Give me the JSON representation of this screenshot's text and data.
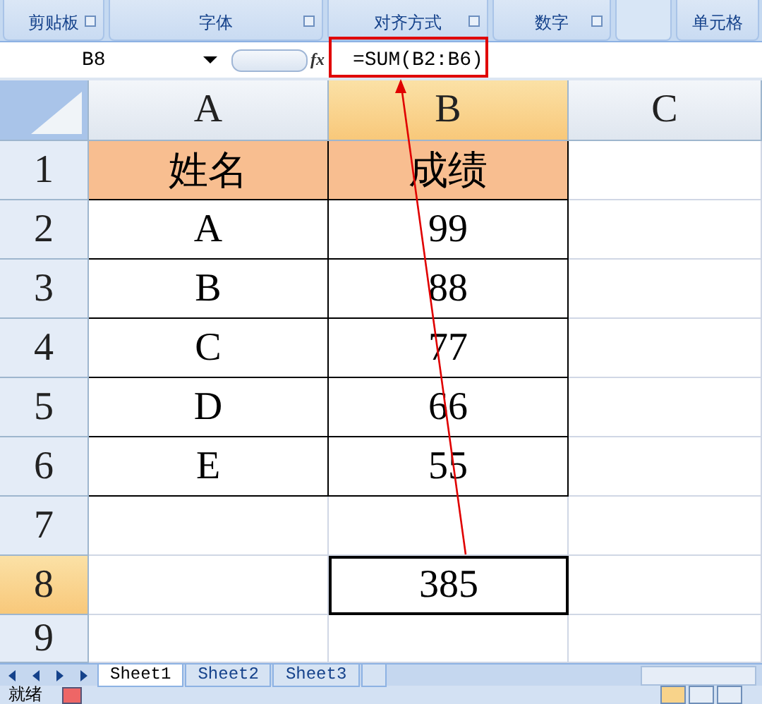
{
  "ribbon": {
    "groups": [
      "剪贴板",
      "字体",
      "对齐方式",
      "数字",
      "单元格"
    ]
  },
  "formula_bar": {
    "name_box": "B8",
    "function_label": "fx",
    "formula": "=SUM(B2:B6)"
  },
  "columns": [
    "A",
    "B",
    "C"
  ],
  "rows": [
    {
      "number": "1",
      "cells": [
        {
          "text": "姓名",
          "kind": "header",
          "bordered": true,
          "selected": false
        },
        {
          "text": "成绩",
          "kind": "header",
          "bordered": true,
          "selected": false
        },
        {
          "bordered": false,
          "selected": false
        }
      ]
    },
    {
      "number": "2",
      "cells": [
        {
          "text": "A",
          "bordered": true,
          "selected": false
        },
        {
          "text": "99",
          "bordered": true,
          "selected": false
        },
        {
          "bordered": false,
          "selected": false
        }
      ]
    },
    {
      "number": "3",
      "cells": [
        {
          "text": "B",
          "bordered": true,
          "selected": false
        },
        {
          "text": "88",
          "bordered": true,
          "selected": false
        },
        {
          "bordered": false,
          "selected": false
        }
      ]
    },
    {
      "number": "4",
      "cells": [
        {
          "text": "C",
          "bordered": true,
          "selected": false
        },
        {
          "text": "77",
          "bordered": true,
          "selected": false
        },
        {
          "bordered": false,
          "selected": false
        }
      ]
    },
    {
      "number": "5",
      "cells": [
        {
          "text": "D",
          "bordered": true,
          "selected": false
        },
        {
          "text": "66",
          "bordered": true,
          "selected": false
        },
        {
          "bordered": false,
          "selected": false
        }
      ]
    },
    {
      "number": "6",
      "cells": [
        {
          "text": "E",
          "bordered": true,
          "selected": false
        },
        {
          "text": "55",
          "bordered": true,
          "selected": false
        },
        {
          "bordered": false,
          "selected": false
        }
      ]
    },
    {
      "number": "7",
      "cells": [
        {
          "bordered": false,
          "selected": false
        },
        {
          "bordered": false,
          "selected": false
        },
        {
          "bordered": false,
          "selected": false
        }
      ]
    },
    {
      "number": "8",
      "cells": [
        {
          "bordered": false,
          "selected": false
        },
        {
          "text": "385",
          "bordered": false,
          "selected": true
        },
        {
          "bordered": false,
          "selected": false
        }
      ]
    },
    {
      "number": "9",
      "cells": [
        {
          "bordered": false,
          "selected": false
        },
        {
          "bordered": false,
          "selected": false
        },
        {
          "bordered": false,
          "selected": false
        }
      ]
    }
  ],
  "sheet_tabs": [
    {
      "label": "Sheet1",
      "selected": true
    },
    {
      "label": "Sheet2",
      "selected": false
    },
    {
      "label": "Sheet3",
      "selected": false
    }
  ],
  "status_bar": {
    "text": "就绪"
  }
}
